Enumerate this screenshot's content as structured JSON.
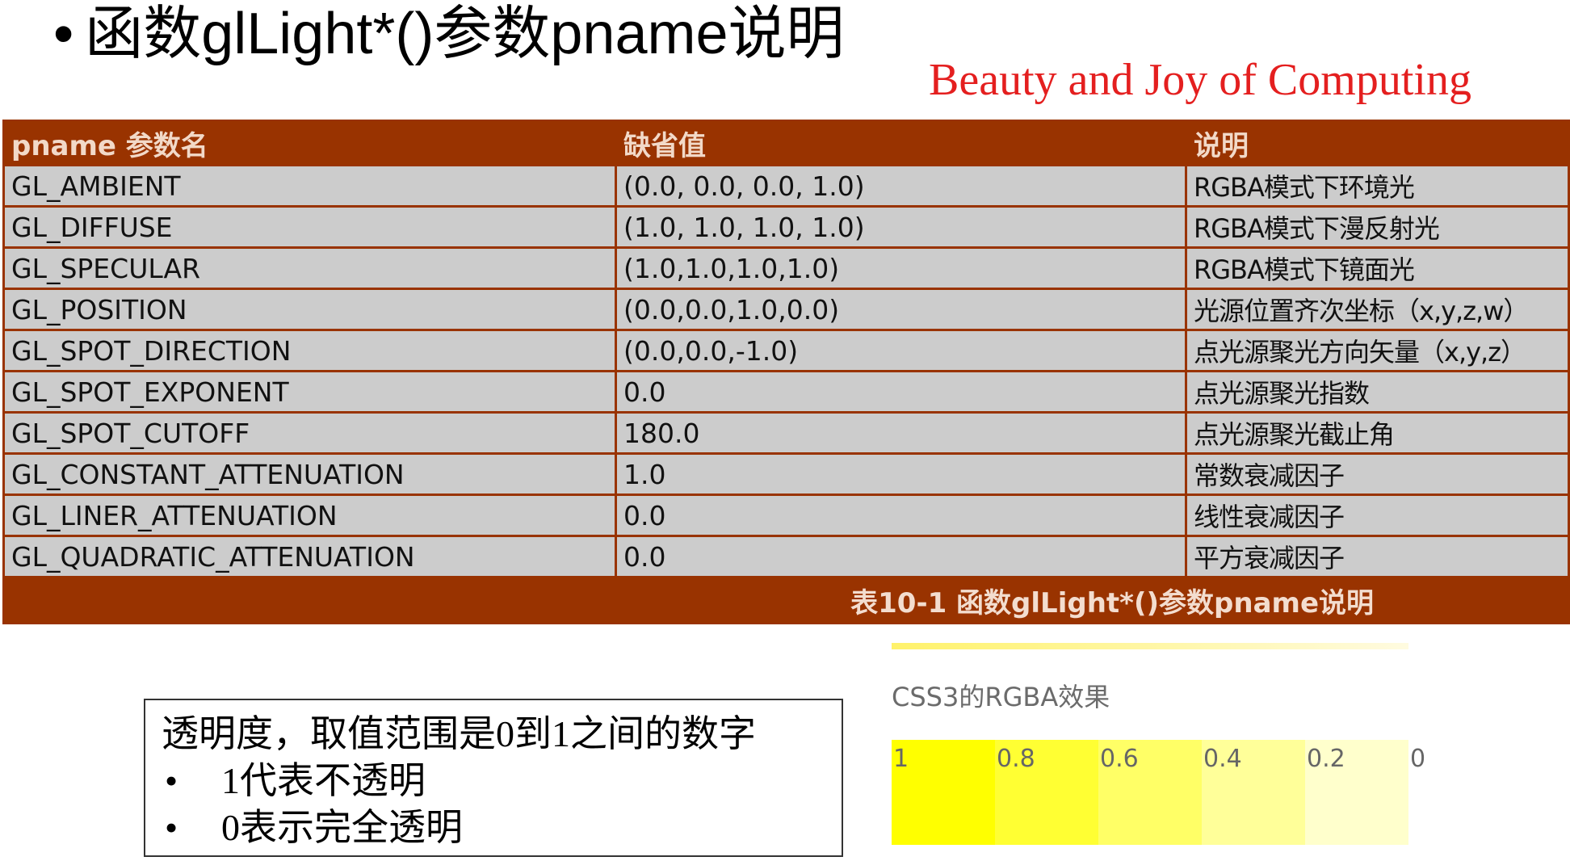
{
  "slide": {
    "bullet": "•",
    "title": "函数glLight*()参数pname说明",
    "watermark": "Beauty and Joy of Computing"
  },
  "table": {
    "headers": [
      "pname 参数名",
      "缺省值",
      "说明"
    ],
    "rows": [
      [
        "GL_AMBIENT",
        "(0.0, 0.0, 0.0, 1.0)",
        "RGBA模式下环境光"
      ],
      [
        "GL_DIFFUSE",
        "(1.0, 1.0, 1.0, 1.0)",
        "RGBA模式下漫反射光"
      ],
      [
        "GL_SPECULAR",
        "(1.0,1.0,1.0,1.0)",
        "RGBA模式下镜面光"
      ],
      [
        "GL_POSITION",
        "(0.0,0.0,1.0,0.0)",
        "光源位置齐次坐标（x,y,z,w）"
      ],
      [
        "GL_SPOT_DIRECTION",
        "(0.0,0.0,-1.0)",
        "点光源聚光方向矢量（x,y,z）"
      ],
      [
        "GL_SPOT_EXPONENT",
        "0.0",
        "点光源聚光指数"
      ],
      [
        "GL_SPOT_CUTOFF",
        "180.0",
        "点光源聚光截止角"
      ],
      [
        "GL_CONSTANT_ATTENUATION",
        "1.0",
        "常数衰减因子"
      ],
      [
        "GL_LINER_ATTENUATION",
        "0.0",
        "线性衰减因子"
      ],
      [
        "GL_QUADRATIC_ATTENUATION",
        "0.0",
        "平方衰减因子"
      ]
    ],
    "caption": "表10-1 函数glLight*()参数pname说明",
    "colors": {
      "header_bg": "#993300",
      "cell_bg": "#cccccc"
    }
  },
  "note": {
    "line1": "透明度，取值范围是0到1之间的数字",
    "bullet": "•",
    "item1": "1代表不透明",
    "item2": "0表示完全透明"
  },
  "rgba_demo": {
    "title": "CSS3的RGBA效果",
    "base_color": "#ffff00",
    "swatches": [
      {
        "label": "1",
        "alpha": 1.0
      },
      {
        "label": "0.8",
        "alpha": 0.8
      },
      {
        "label": "0.6",
        "alpha": 0.6
      },
      {
        "label": "0.4",
        "alpha": 0.4
      },
      {
        "label": "0.2",
        "alpha": 0.2
      },
      {
        "label": "0",
        "alpha": 0.0
      }
    ]
  }
}
